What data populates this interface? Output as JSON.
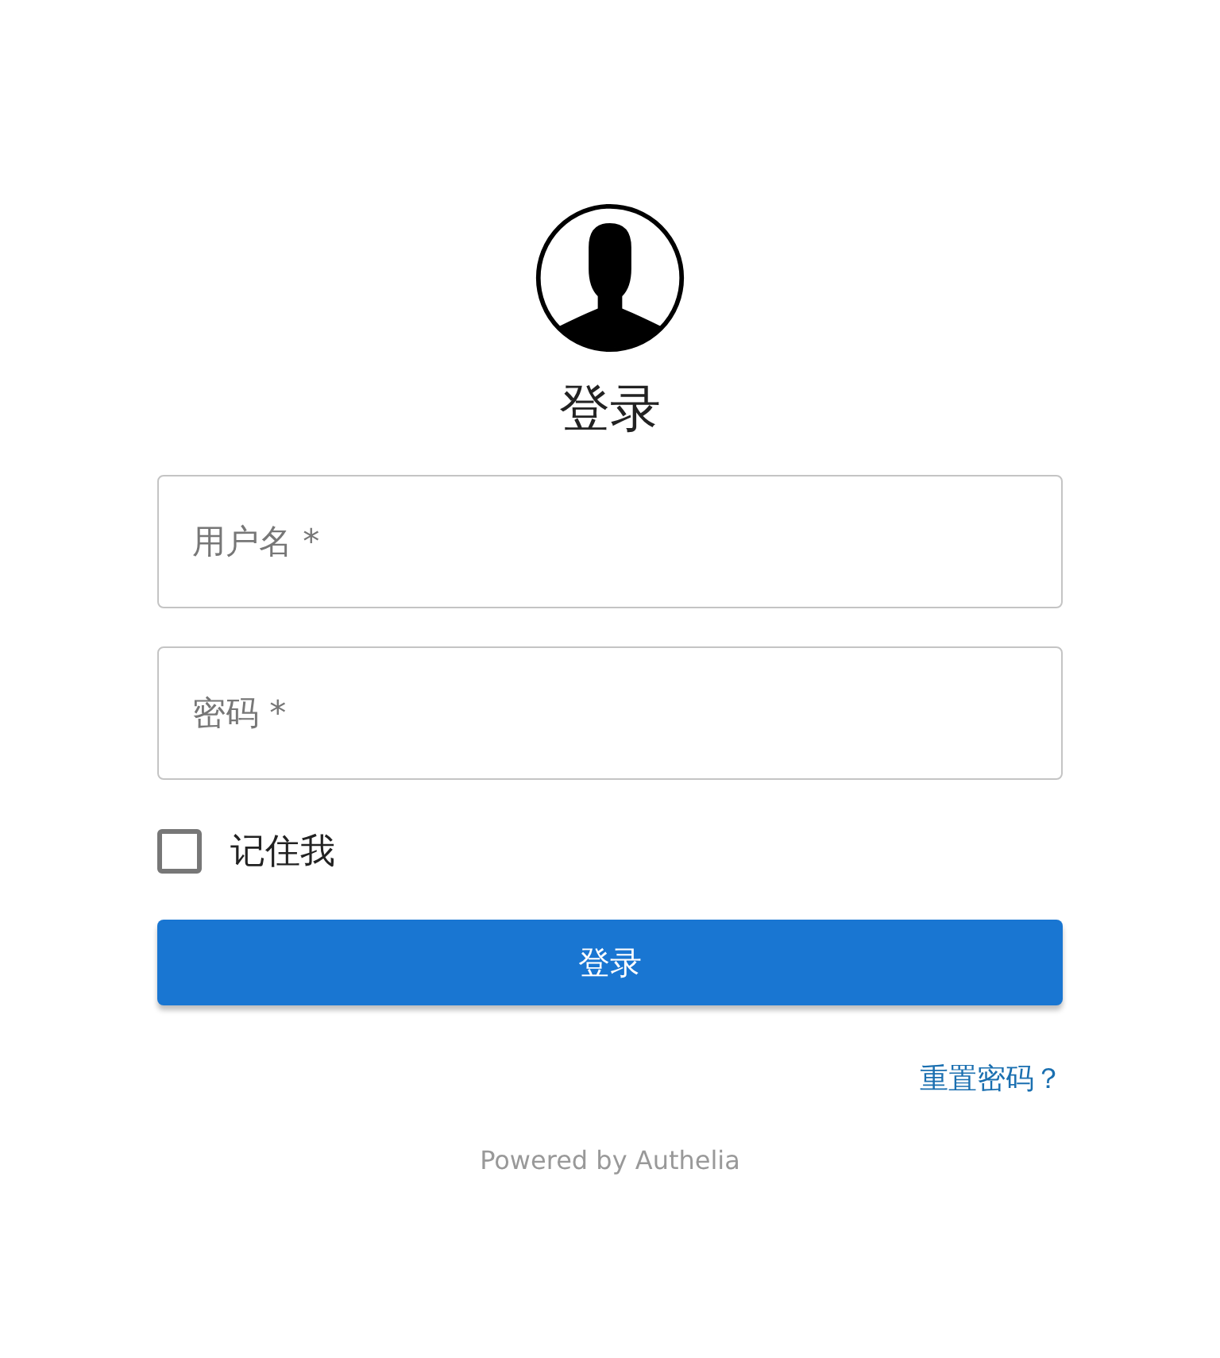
{
  "title": "登录",
  "fields": [
    {
      "placeholder": "用户名 *"
    },
    {
      "placeholder": "密码 *"
    }
  ],
  "remember": {
    "label": "记住我",
    "checked": false
  },
  "submit": "登录",
  "reset_link": "重置密码？",
  "footer": "Powered by Authelia"
}
